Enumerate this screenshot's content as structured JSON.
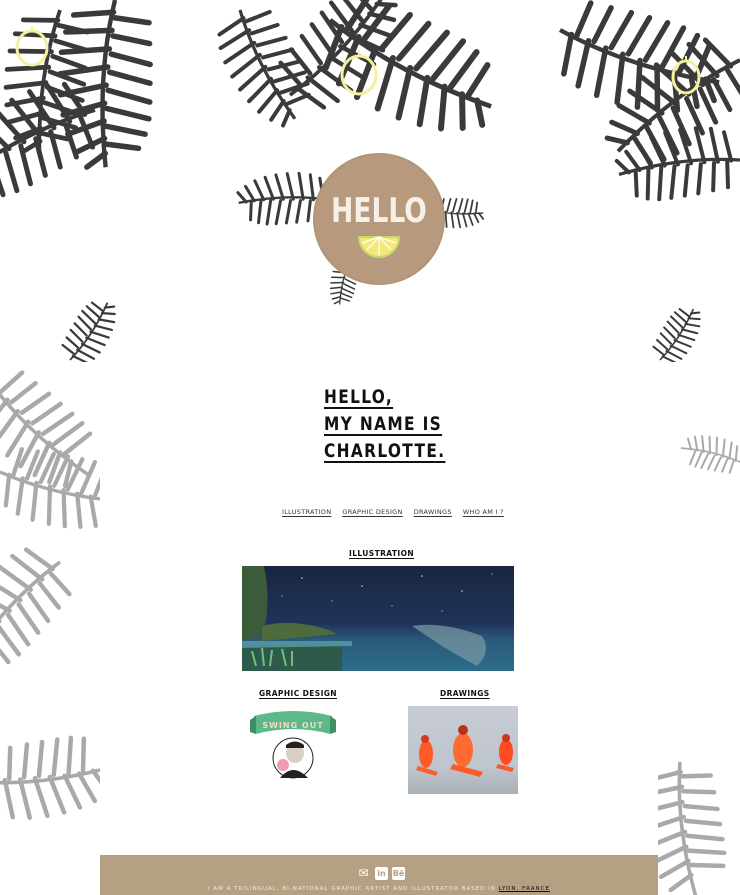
{
  "hero": {
    "badge_text": "HELLO"
  },
  "intro": {
    "lines": [
      "HELLO,",
      "MY NAME IS",
      "CHARLOTTE."
    ]
  },
  "nav": {
    "items": [
      "ILLUSTRATION",
      "GRAPHIC DESIGN",
      "DRAWINGS",
      "WHO AM I ?"
    ]
  },
  "sections": {
    "illustration": "ILLUSTRATION",
    "graphic_design": "GRAPHIC DESIGN",
    "drawings": "DRAWINGS",
    "banner_text": "SWING OUT"
  },
  "footer": {
    "icons": [
      "mail-icon",
      "linkedin-icon",
      "behance-icon"
    ],
    "linkedin_label": "in",
    "behance_label": "Bē",
    "text": "I AM A TRILINGUAL, BI-NATIONAL GRAPHIC ARTIST AND ILLUSTRATOR BASED IN",
    "location_link": "LYON, FRANCE"
  },
  "colors": {
    "badge": "#b79a7d",
    "footer": "#b6a084",
    "leaf_dark": "#3a3a3a",
    "leaf_gray": "#a9a9a9",
    "lemon": "#f3f0a0"
  }
}
